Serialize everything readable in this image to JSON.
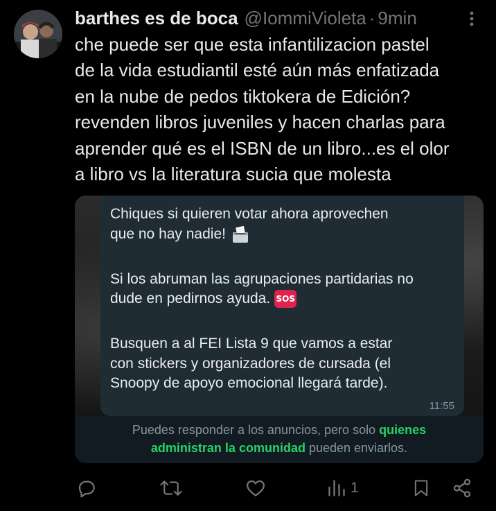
{
  "tweet": {
    "author_name": "barthes es de boca",
    "handle": "@IommiVioleta",
    "separator": "·",
    "time": "9min",
    "text_lines": [
      "che puede ser que esta infantilizacion pastel",
      "de la vida estudiantil esté aún más enfatizada",
      "en la nube de pedos tiktokera de Edición?",
      "revenden libros juveniles y hacen charlas para",
      "aprender qué es el ISBN de un libro...es el olor",
      "a libro vs la literatura sucia que molesta"
    ]
  },
  "media": {
    "message": {
      "p1_lines": [
        "Chiques si quieren votar ahora aprovechen",
        "que no hay nadie!"
      ],
      "p2_lines": [
        "Si los abruman las agrupaciones partidarias no",
        "dude en pedirnos ayuda."
      ],
      "sos_label": "SOS",
      "p3_lines": [
        "Busquen a al FEI Lista 9 que vamos a estar",
        "con stickers y organizadores de cursada (el",
        "Snoopy de apoyo emocional llegará tarde)."
      ],
      "time": "11:55"
    },
    "notice": {
      "part1": "Puedes responder a los anuncios, pero solo",
      "link1": "quienes",
      "link2": "administran la comunidad",
      "part2": "pueden enviarlos."
    }
  },
  "actions": {
    "views_count": "1",
    "icons": [
      "reply-icon",
      "retweet-icon",
      "like-icon",
      "views-icon",
      "bookmark-icon",
      "share-icon"
    ]
  },
  "colors": {
    "background": "#000000",
    "text": "#e7e9ea",
    "muted": "#71767b",
    "whatsapp_bubble": "#202c33",
    "whatsapp_green": "#25d366"
  }
}
